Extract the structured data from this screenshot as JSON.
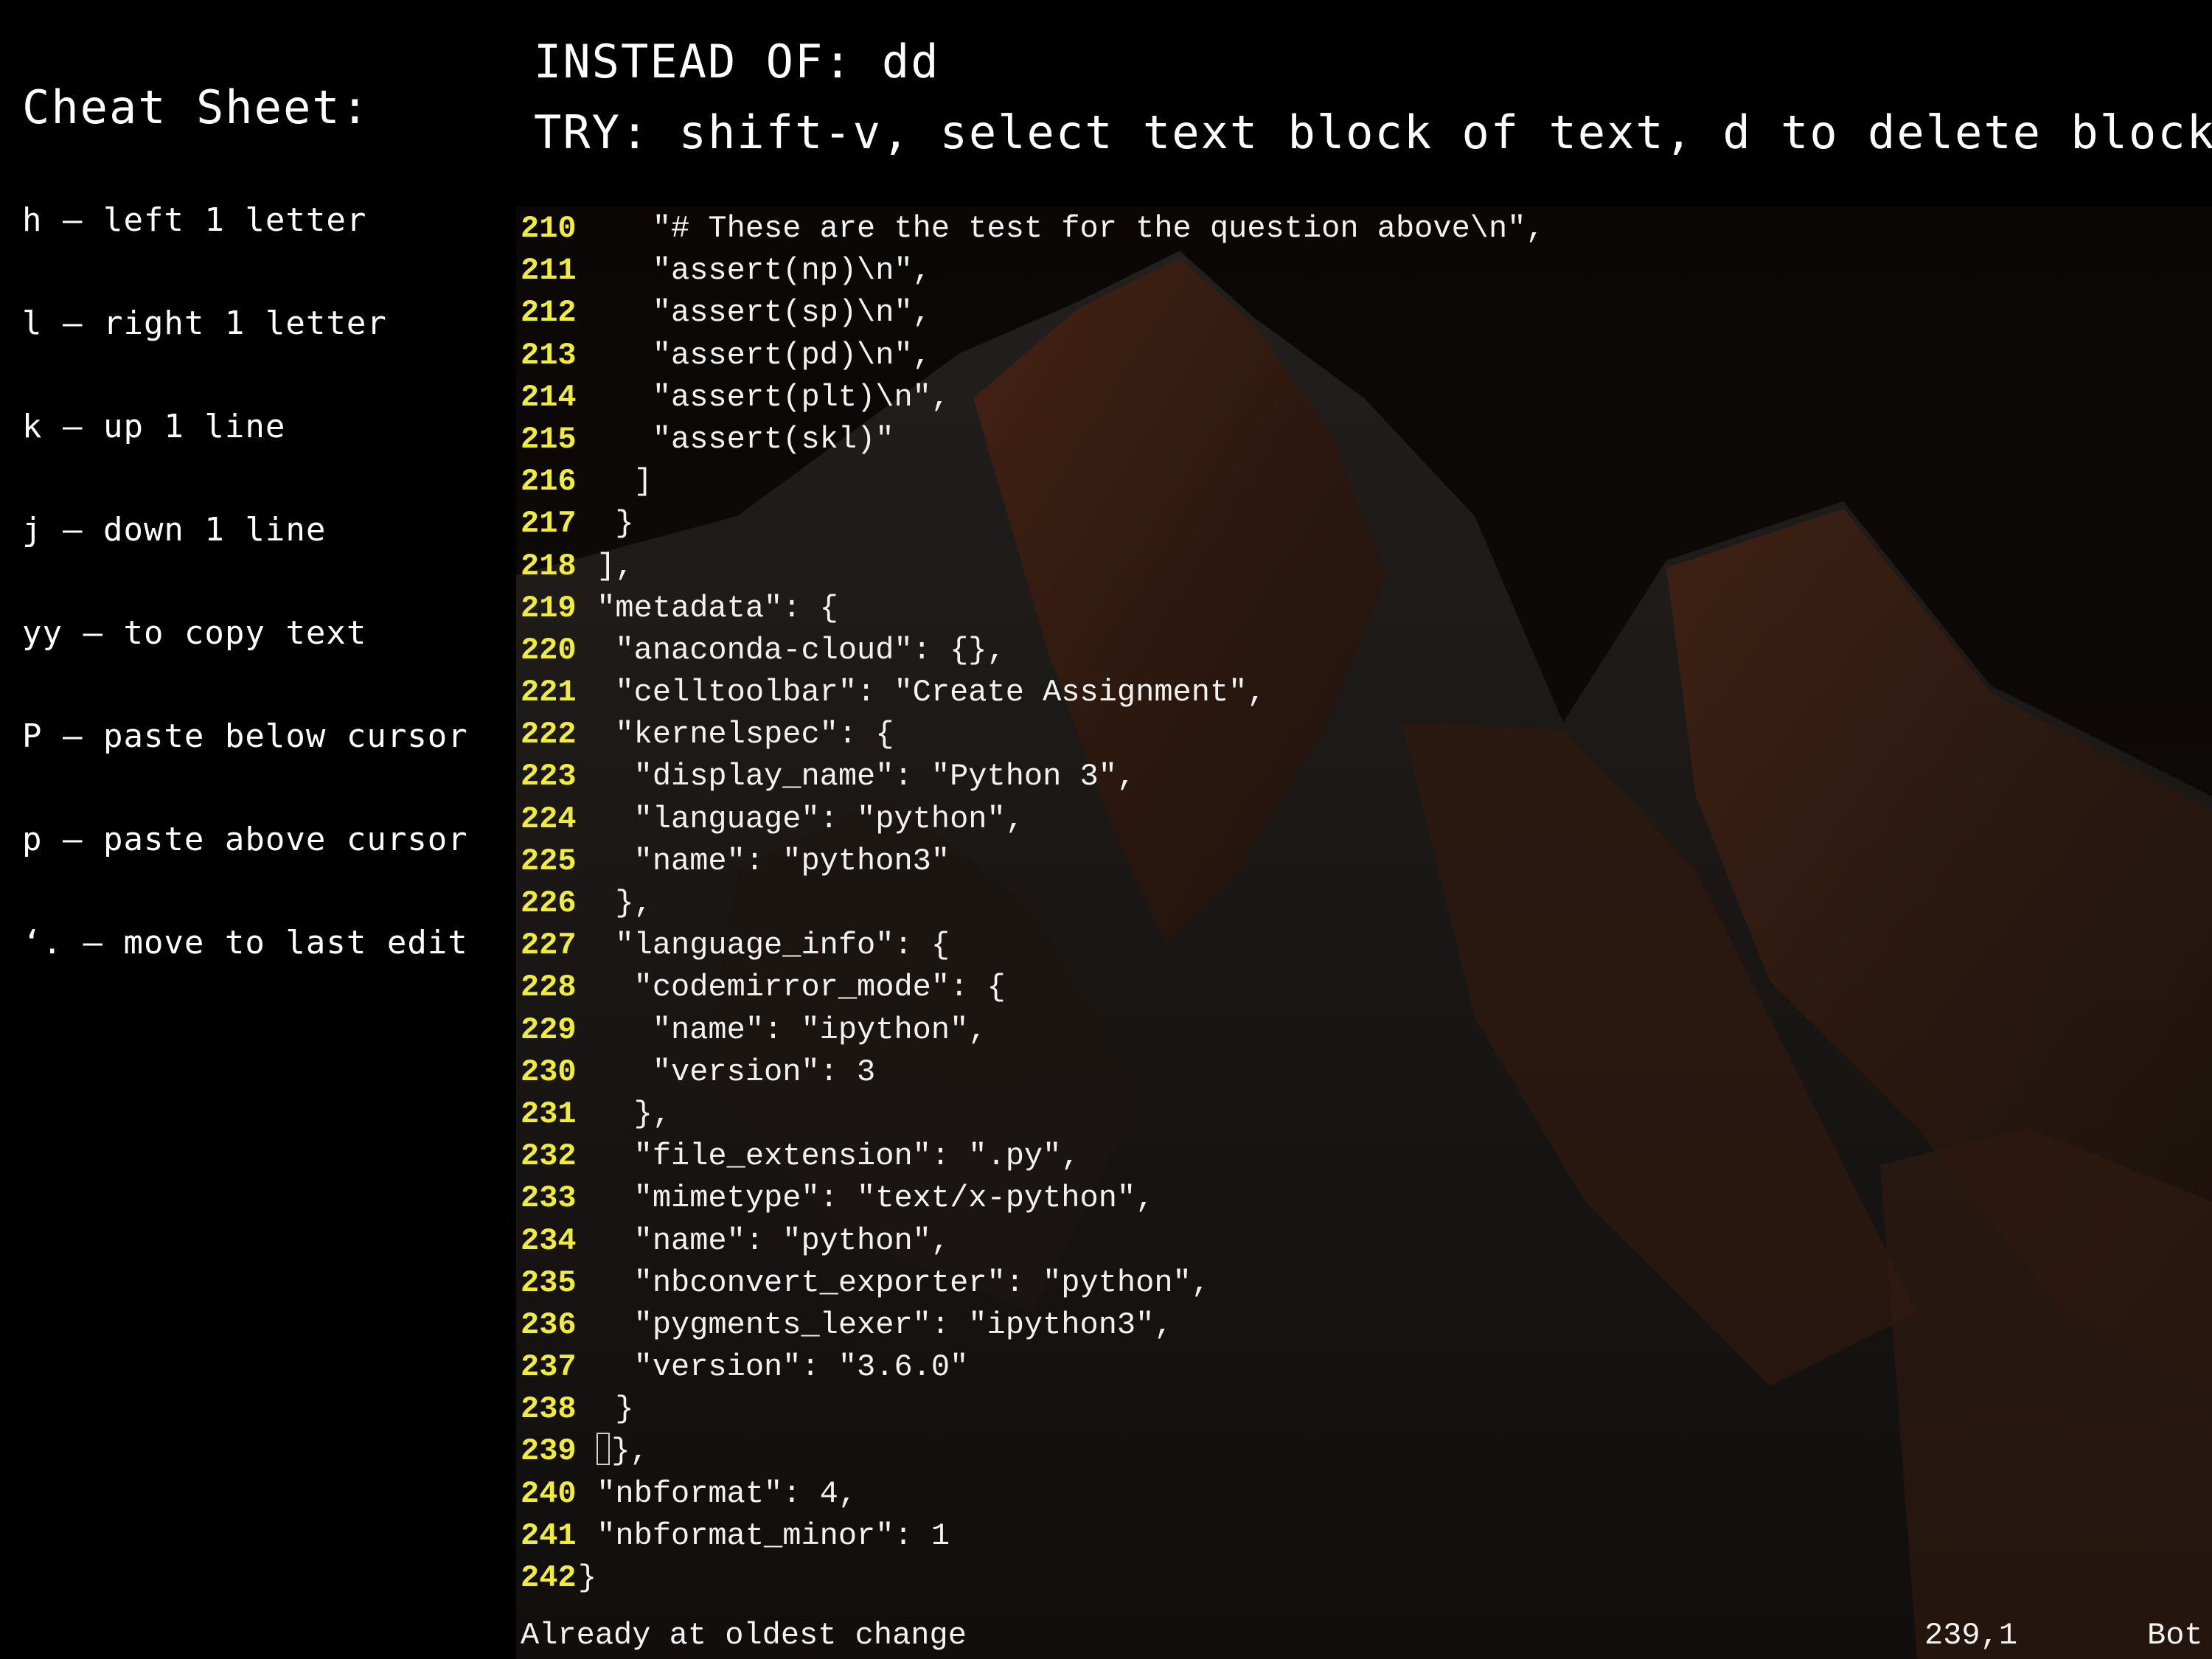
{
  "cheat_sheet": {
    "title": "Cheat Sheet:",
    "items": [
      "h – left 1 letter",
      "l – right 1 letter",
      "k – up 1 line",
      "j – down 1 line",
      "yy – to copy text",
      "P – paste below cursor",
      "p – paste above cursor",
      "‘. – move to last edit"
    ]
  },
  "banner": {
    "instead_of": "INSTEAD OF: dd",
    "try": "TRY: shift-v, select text block of text, d to delete block!"
  },
  "editor": {
    "colors": {
      "line_number": "#f1ec39",
      "text": "#f2f2f2",
      "background": "#000000"
    },
    "lines": [
      {
        "n": "210",
        "text": "    \"# These are the test for the question above\\n\","
      },
      {
        "n": "211",
        "text": "    \"assert(np)\\n\","
      },
      {
        "n": "212",
        "text": "    \"assert(sp)\\n\","
      },
      {
        "n": "213",
        "text": "    \"assert(pd)\\n\","
      },
      {
        "n": "214",
        "text": "    \"assert(plt)\\n\","
      },
      {
        "n": "215",
        "text": "    \"assert(skl)\""
      },
      {
        "n": "216",
        "text": "   ]"
      },
      {
        "n": "217",
        "text": "  }"
      },
      {
        "n": "218",
        "text": " ],"
      },
      {
        "n": "219",
        "text": " \"metadata\": {"
      },
      {
        "n": "220",
        "text": "  \"anaconda-cloud\": {},"
      },
      {
        "n": "221",
        "text": "  \"celltoolbar\": \"Create Assignment\","
      },
      {
        "n": "222",
        "text": "  \"kernelspec\": {"
      },
      {
        "n": "223",
        "text": "   \"display_name\": \"Python 3\","
      },
      {
        "n": "224",
        "text": "   \"language\": \"python\","
      },
      {
        "n": "225",
        "text": "   \"name\": \"python3\""
      },
      {
        "n": "226",
        "text": "  },"
      },
      {
        "n": "227",
        "text": "  \"language_info\": {"
      },
      {
        "n": "228",
        "text": "   \"codemirror_mode\": {"
      },
      {
        "n": "229",
        "text": "    \"name\": \"ipython\","
      },
      {
        "n": "230",
        "text": "    \"version\": 3"
      },
      {
        "n": "231",
        "text": "   },"
      },
      {
        "n": "232",
        "text": "   \"file_extension\": \".py\","
      },
      {
        "n": "233",
        "text": "   \"mimetype\": \"text/x-python\","
      },
      {
        "n": "234",
        "text": "   \"name\": \"python\","
      },
      {
        "n": "235",
        "text": "   \"nbconvert_exporter\": \"python\","
      },
      {
        "n": "236",
        "text": "   \"pygments_lexer\": \"ipython3\","
      },
      {
        "n": "237",
        "text": "   \"version\": \"3.6.0\""
      },
      {
        "n": "238",
        "text": "  }"
      },
      {
        "n": "239",
        "text": "},",
        "cursor": true
      },
      {
        "n": "240",
        "text": " \"nbformat\": 4,"
      },
      {
        "n": "241",
        "text": " \"nbformat_minor\": 1"
      },
      {
        "n": "242",
        "text": "}"
      }
    ],
    "status": {
      "message": "Already at oldest change",
      "position": "239,1",
      "scroll": "Bot"
    }
  }
}
